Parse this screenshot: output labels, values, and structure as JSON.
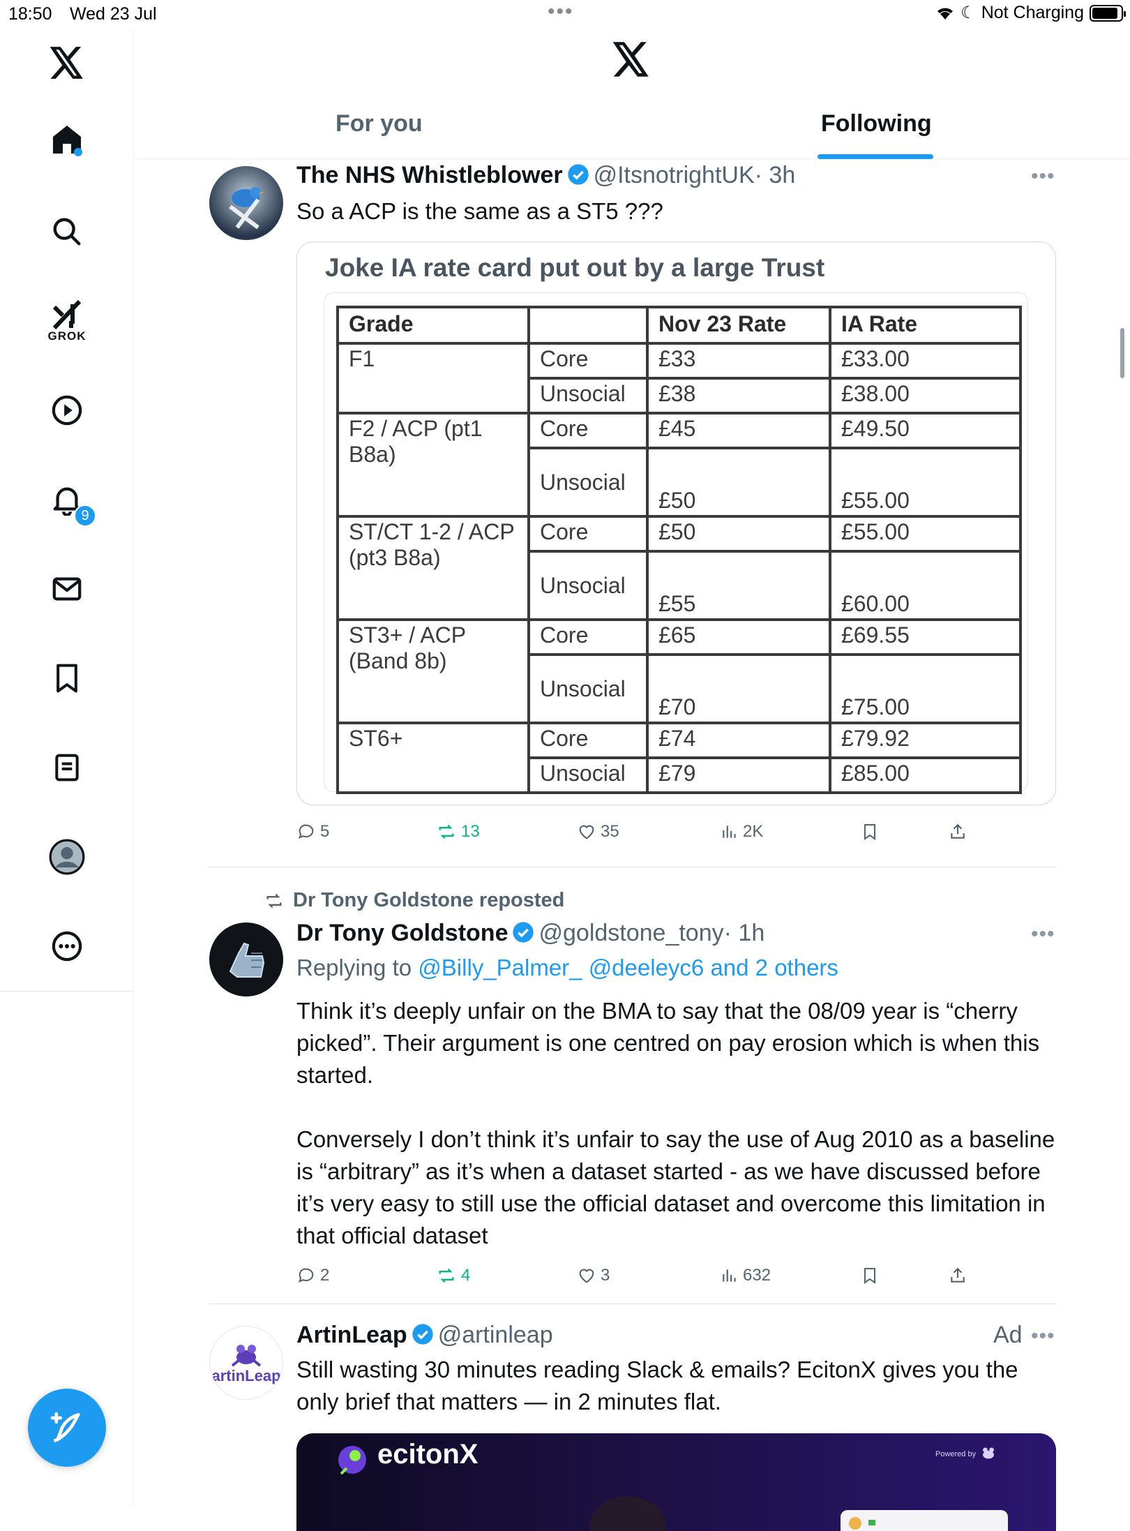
{
  "status_bar": {
    "time": "18:50",
    "date": "Wed 23 Jul",
    "charging": "Not Charging",
    "battery_level": 0.9
  },
  "sidebar": {
    "items": [
      {
        "name": "x-logo",
        "label": "X"
      },
      {
        "name": "home",
        "label": "Home"
      },
      {
        "name": "search",
        "label": "Explore"
      },
      {
        "name": "grok",
        "label": "GROK"
      },
      {
        "name": "video",
        "label": "Video"
      },
      {
        "name": "notifications",
        "label": "Notifications"
      },
      {
        "name": "messages",
        "label": "Messages"
      },
      {
        "name": "bookmarks",
        "label": "Bookmarks"
      },
      {
        "name": "lists",
        "label": "Lists"
      },
      {
        "name": "profile",
        "label": "Profile"
      },
      {
        "name": "more",
        "label": "More"
      }
    ],
    "notifications_badge": "9"
  },
  "header": {
    "tabs": [
      {
        "label": "For you"
      },
      {
        "label": "Following"
      }
    ],
    "active_tab": "Following"
  },
  "posts": [
    {
      "name": "The NHS Whistleblower",
      "handle": "@ItsnotrightUK",
      "time": "· 3h",
      "text": "So a ACP is the same as a ST5 ???",
      "card": {
        "title": "Joke IA rate card put out by a large Trust",
        "headers": [
          "Grade",
          "",
          "Nov 23 Rate",
          "IA Rate"
        ],
        "groups": [
          {
            "grade": "F1",
            "rows": [
              [
                "Core",
                "£33",
                "£33.00"
              ],
              [
                "Unsocial",
                "£38",
                "£38.00"
              ]
            ]
          },
          {
            "grade": "F2 / ACP (pt1 B8a)",
            "rows": [
              [
                "Core",
                "£45",
                "£49.50"
              ],
              [
                "Unsocial",
                "£50",
                "£55.00"
              ]
            ]
          },
          {
            "grade": "ST/CT 1-2 / ACP (pt3 B8a)",
            "rows": [
              [
                "Core",
                "£50",
                "£55.00"
              ],
              [
                "Unsocial",
                "£55",
                "£60.00"
              ]
            ]
          },
          {
            "grade": "ST3+ / ACP (Band 8b)",
            "rows": [
              [
                "Core",
                "£65",
                "£69.55"
              ],
              [
                "Unsocial",
                "£70",
                "£75.00"
              ]
            ]
          },
          {
            "grade": "ST6+",
            "rows": [
              [
                "Core",
                "£74",
                "£79.92"
              ],
              [
                "Unsocial",
                "£79",
                "£85.00"
              ]
            ]
          }
        ]
      },
      "stats": {
        "replies": "5",
        "reposts": "13",
        "likes": "35",
        "views": "2K"
      }
    },
    {
      "repost_label": "Dr Tony Goldstone reposted",
      "name": "Dr Tony Goldstone",
      "handle": "@goldstone_tony",
      "time": "· 1h",
      "replying_prefix": "Replying to",
      "replying_to": "@Billy_Palmer_ @deeleyc6 and 2 others",
      "text_p1": "Think it’s deeply unfair on the BMA to say that the 08/09 year is “cherry picked”. Their argument is one centred on pay erosion which is when this started.",
      "text_p2": "Conversely I don’t think it’s unfair to say the use of Aug 2010 as a baseline is “arbitrary” as it’s when a dataset started - as we have discussed before it’s very easy to still use the official dataset and overcome this limitation in that official dataset",
      "stats": {
        "replies": "2",
        "reposts": "4",
        "likes": "3",
        "views": "632"
      }
    },
    {
      "name": "ArtinLeap",
      "handle": "@artinleap",
      "ad_label": "Ad",
      "avatar_text": "artinLeap",
      "text": "Still wasting 30 minutes reading Slack & emails? EcitonX gives you the only brief that matters — in 2 minutes flat.",
      "image_brand": "ecitonX",
      "image_powered": "Powered by"
    }
  ],
  "colors": {
    "accent": "#1d9bf0",
    "repost": "#00ba7c",
    "muted": "#536471"
  }
}
